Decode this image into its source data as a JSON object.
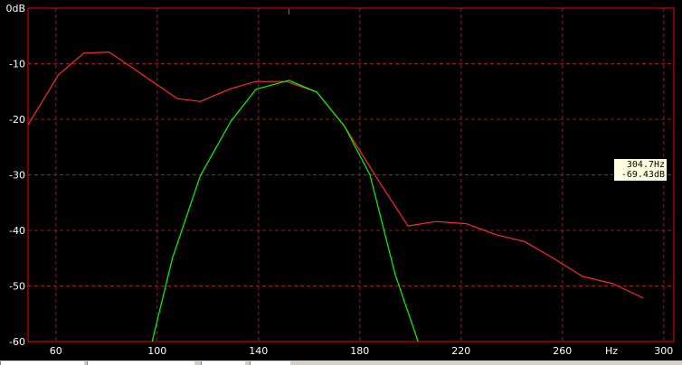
{
  "chart_data": {
    "type": "line",
    "xlabel": "Hz",
    "ylabel": "",
    "xlim": [
      49,
      304
    ],
    "ylim": [
      -60,
      0
    ],
    "x_ticks": [
      60,
      100,
      140,
      180,
      220,
      260,
      300
    ],
    "y_ticks": [
      0,
      -10,
      -20,
      -30,
      -40,
      -50,
      -60
    ],
    "x_tick_labels": [
      "60",
      "100",
      "140",
      "180",
      "220",
      "260",
      "300"
    ],
    "y_tick_labels": [
      "0dB",
      "-10",
      "-20",
      "-30",
      "-40",
      "-50",
      "-60"
    ],
    "grid": true,
    "colors": {
      "background": "#000000",
      "axis": "#ff0000",
      "grid": "#9b1a1a",
      "text": "#ffffff"
    },
    "series": [
      {
        "color": "#ff2a2a",
        "x": [
          49,
          61,
          71,
          81,
          91,
          108,
          117,
          129,
          139,
          151,
          163,
          174,
          188,
          199,
          210,
          222,
          234,
          245,
          256,
          268,
          280,
          292
        ],
        "y": [
          -21,
          -12,
          -8.1,
          -7.9,
          -11,
          -16.3,
          -16.8,
          -14.5,
          -13.2,
          -13.2,
          -15.1,
          -21.3,
          -31.5,
          -39.2,
          -38.4,
          -38.8,
          -40.8,
          -42,
          -44.9,
          -48.3,
          -49.6,
          -52.2
        ]
      },
      {
        "color": "#00ff00",
        "x": [
          98,
          106,
          117,
          129,
          139,
          152,
          163,
          174,
          184,
          194,
          203
        ],
        "y": [
          -60,
          -45,
          -30.2,
          -20.4,
          -14.6,
          -13,
          -15.1,
          -21.3,
          -30,
          -48,
          -60
        ]
      }
    ],
    "cursor": {
      "x": 152
    },
    "readout": {
      "freq": "304.7Hz",
      "level": "-69.43dB"
    }
  }
}
